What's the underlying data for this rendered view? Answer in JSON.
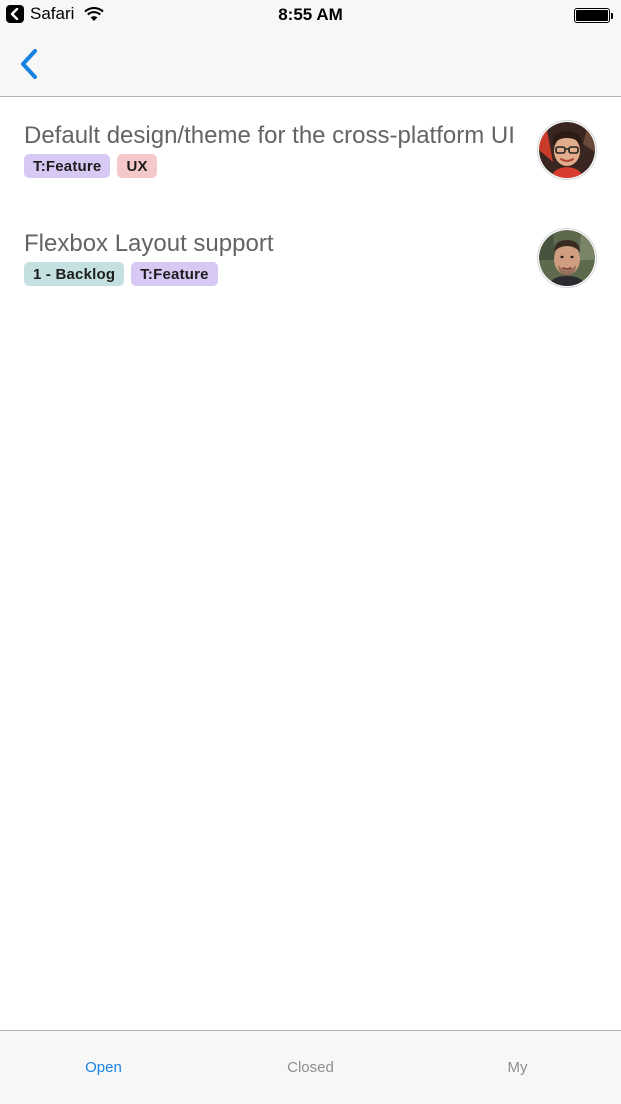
{
  "status_bar": {
    "back_app": "Safari",
    "time": "8:55 AM"
  },
  "nav": {
    "back_icon": "chevron-left-icon",
    "accent_color": "#1a82e2"
  },
  "issues": [
    {
      "title": "Default design/theme for the cross-platform UI",
      "labels": [
        {
          "text": "T:Feature",
          "color": "#d7c9f4"
        },
        {
          "text": "UX",
          "color": "#f5c9c9"
        }
      ],
      "assignee_avatar": "woman-with-glasses-avatar"
    },
    {
      "title": "Flexbox Layout support",
      "labels": [
        {
          "text": "1 - Backlog",
          "color": "#c5e0e0"
        },
        {
          "text": "T:Feature",
          "color": "#d7c9f4"
        }
      ],
      "assignee_avatar": "man-avatar"
    }
  ],
  "tabs": [
    {
      "label": "Open",
      "active": true
    },
    {
      "label": "Closed",
      "active": false
    },
    {
      "label": "My",
      "active": false
    }
  ]
}
